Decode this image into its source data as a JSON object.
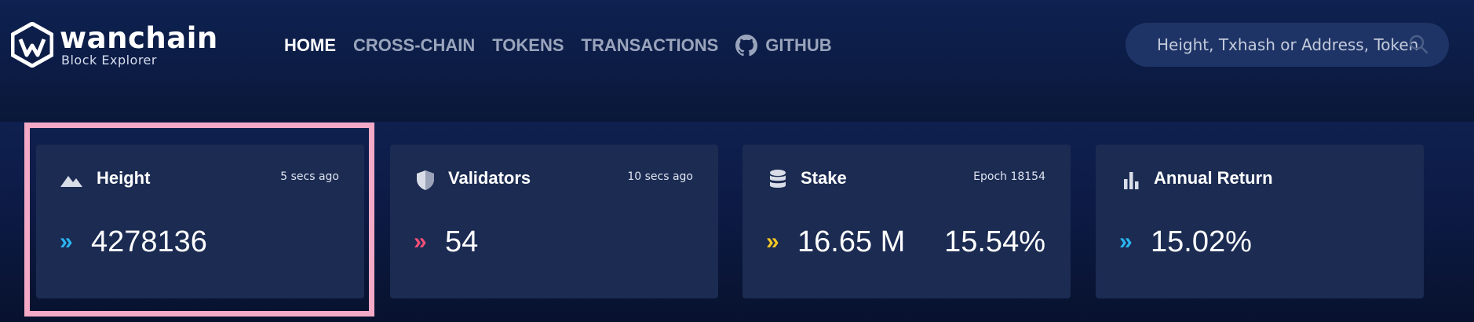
{
  "brand": {
    "name": "wanchain",
    "subtitle": "Block Explorer",
    "logo_icon": "wanchain-logo-icon"
  },
  "nav": {
    "items": [
      {
        "label": "HOME",
        "active": true
      },
      {
        "label": "CROSS-CHAIN",
        "active": false
      },
      {
        "label": "TOKENS",
        "active": false
      },
      {
        "label": "TRANSACTIONS",
        "active": false
      },
      {
        "label": "GITHUB",
        "active": false,
        "icon": "github-icon"
      }
    ]
  },
  "search": {
    "placeholder": "Height, Txhash or Address, Token Add",
    "icon": "search-icon"
  },
  "cards": [
    {
      "title": "Height",
      "meta": "5 secs ago",
      "value": "4278136",
      "value2": "",
      "icon": "mountain-icon",
      "chevron": "»",
      "chevron_color": "#2ab4f0",
      "highlighted": true
    },
    {
      "title": "Validators",
      "meta": "10 secs ago",
      "value": "54",
      "value2": "",
      "icon": "shield-icon",
      "chevron": "»",
      "chevron_color": "#ef4f79",
      "highlighted": false
    },
    {
      "title": "Stake",
      "meta": "Epoch 18154",
      "value": "16.65 M",
      "value2": "15.54%",
      "icon": "database-icon",
      "chevron": "»",
      "chevron_color": "#f5c622",
      "highlighted": false
    },
    {
      "title": "Annual Return",
      "meta": "",
      "value": "15.02%",
      "value2": "",
      "icon": "bar-chart-icon",
      "chevron": "»",
      "chevron_color": "#2ab4f0",
      "highlighted": false
    }
  ],
  "colors": {
    "background": "#0b1838",
    "card": "#1b2b52",
    "highlight_border": "#f4a9c6"
  }
}
